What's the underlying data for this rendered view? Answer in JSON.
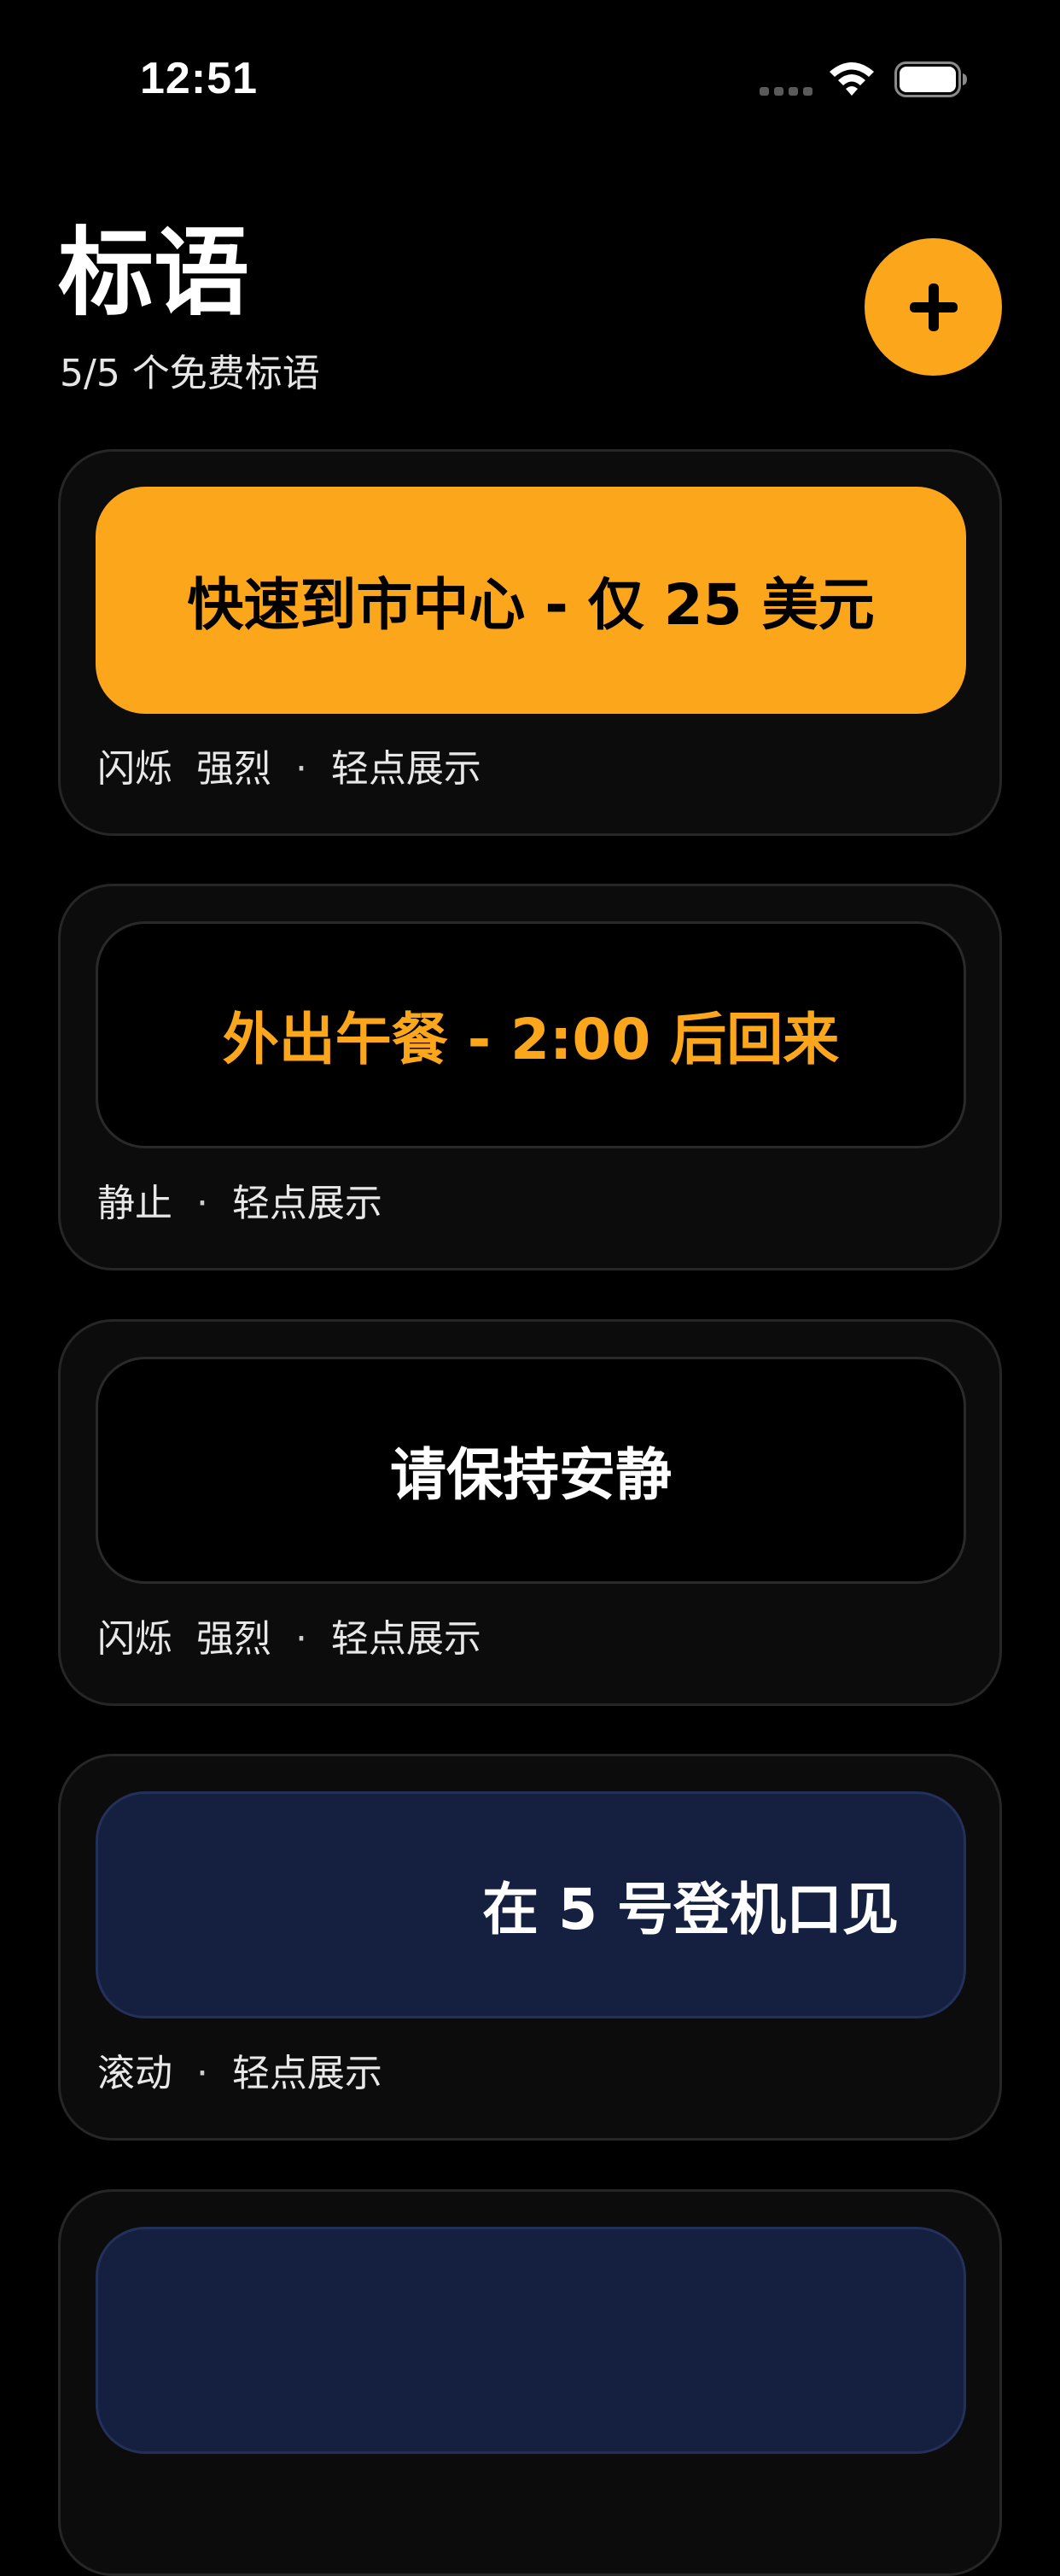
{
  "status_bar": {
    "time": "12:51"
  },
  "header": {
    "title": "标语",
    "subtitle": "5/5 个免费标语"
  },
  "colors": {
    "accent": "#fca61c",
    "card_bg": "#0c0c0c",
    "card_border": "#262626",
    "banner_dark": "#000000",
    "banner_navy": "#152040"
  },
  "cards": [
    {
      "text": "快速到市中心 - 仅 25 美元",
      "modes": "闪烁  强烈",
      "action": "轻点展示",
      "style": "filled-orange"
    },
    {
      "text": "外出午餐 - 2:00 后回来",
      "modes": "静止",
      "action": "轻点展示",
      "style": "dark-orange-text"
    },
    {
      "text": "请保持安静",
      "modes": "闪烁  强烈",
      "action": "轻点展示",
      "style": "dark-white-text"
    },
    {
      "text": "在 5 号登机口见",
      "modes": "滚动",
      "action": "轻点展示",
      "style": "navy-scrolling"
    },
    {
      "text": "",
      "modes": "",
      "action": "",
      "style": "navy-partial"
    }
  ],
  "icons": {
    "add": "plus-icon",
    "wifi": "wifi-icon",
    "battery": "battery-icon",
    "signal": "cellular-signal-icon"
  }
}
